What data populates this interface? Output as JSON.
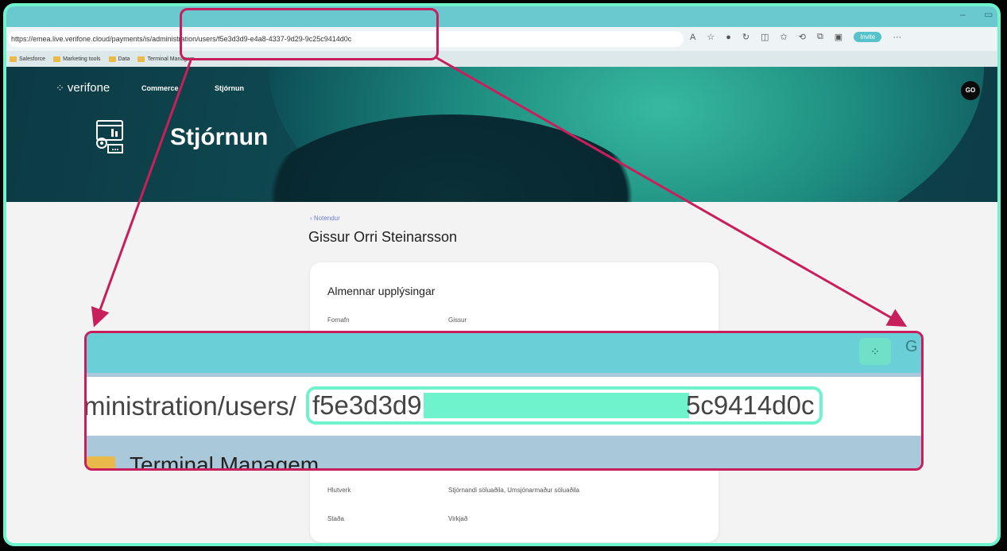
{
  "browser": {
    "url": "https://emea.live.verifone.cloud/payments/is/administration/users/f5e3d3d9-e4a8-4337-9d29-9c25c9414d0c",
    "invite_label": "Invite",
    "bookmarks": [
      "Salesforce",
      "Marketing tools",
      "Data",
      "Terminal Managem..."
    ]
  },
  "app": {
    "logo_text": "verifone",
    "nav": [
      "Commerce",
      "Stjórnun"
    ],
    "avatar_initials": "GO",
    "hero_title": "Stjórnun"
  },
  "content": {
    "back_link": "‹ Notendur",
    "user_name": "Gissur Orri Steinarsson",
    "card_title": "Almennar upplýsingar",
    "fields": [
      {
        "label": "Fornafn",
        "value": "Gissur"
      },
      {
        "label": "Hlutverk",
        "value": "Stjórnandi söluaðila, Umsjónarmaður söluaðila"
      },
      {
        "label": "Staða",
        "value": "Virkjað"
      }
    ]
  },
  "zoom": {
    "url_prefix": "ministration/users/",
    "id_start": "f5e3d3d9",
    "id_end": "5c9414d0c",
    "bookmark_text": "Terminal Managem"
  },
  "colors": {
    "highlight_border": "#c81f5c",
    "accent": "#6ff3cc"
  }
}
